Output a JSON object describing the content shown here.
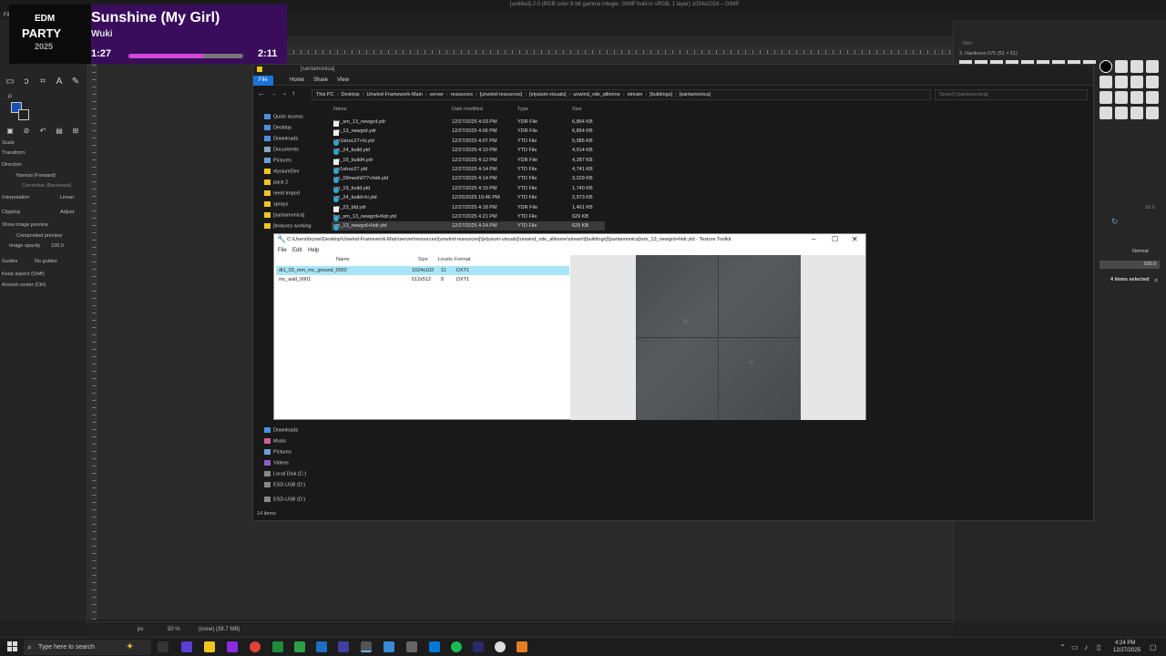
{
  "gimp": {
    "title": "[untitled]-2.0 (RGB color 8-bit gamma integer, GIMP built-in sRGB, 1 layer) 1024x1024 – GIMP",
    "menu": "File",
    "tool_options": {
      "scale": "Scale",
      "transform": "Transform:",
      "direction": "Direction",
      "normal_forward": "Normal (Forward)",
      "corrective_backward": "Corrective (Backward)",
      "interpolation": "Interpolation",
      "interpolation_val": "Linear",
      "clipping": "Clipping",
      "clipping_val": "Adjust",
      "show_preview": "Show image preview",
      "composited_preview": "Composited preview",
      "image_opacity": "Image opacity",
      "image_opacity_val": "100.0",
      "guides": "Guides",
      "guides_val": "No guides",
      "keep_aspect": "Keep aspect (Shift)",
      "around_center": "Around center (Ctrl)"
    },
    "status": {
      "unit": "px",
      "zoom": "50 %",
      "info": "(none) (38.7 MB)"
    },
    "dock": {
      "filter": "filter",
      "brush_name": "2. Hardness 075 (51 × 51)",
      "spacing": "10.0",
      "mode": "Normal",
      "opacity": "100.0",
      "items_selected": "4 items selected"
    }
  },
  "music": {
    "logo_line1": "EDM",
    "logo_line2": "PARTY",
    "logo_line3": "2025",
    "title": "Sunshine (My Girl)",
    "artist": "Wuki",
    "elapsed": "1:27",
    "total": "2:11",
    "progress": 0.66
  },
  "explorer": {
    "title": "[santamonica]",
    "tabs": [
      "File",
      "Home",
      "Share",
      "View"
    ],
    "path": [
      "This PC",
      "Desktop",
      "Unwind-Framework-Main",
      "server",
      "resources",
      "[unwind-resources]",
      "[elysium-visuals]",
      "unwind_vde_allinone",
      "stream",
      "[buildings]",
      "[santamonica]"
    ],
    "search_placeholder": "Search [santamonica]",
    "columns": {
      "name": "Name",
      "date": "Date modified",
      "type": "Type",
      "size": "Size"
    },
    "nav": [
      "Quick access",
      "Desktop",
      "Downloads",
      "Documents",
      "Pictures",
      "elysiumDev",
      "pack 2",
      "need import",
      "sprays",
      "[santamonica]",
      "[textures working",
      "Downloads",
      "Music",
      "Pictures",
      "Videos",
      "Local Disk (C:)",
      "ESD-USB (D:)",
      "ESD-USB (D:)"
    ],
    "files": [
      {
        "name": "hei_sm_13_newgrd.ydr",
        "date": "12/27/2025 4:03 PM",
        "type": "YDR File",
        "size": "6,854 KB",
        "icon": "doc"
      },
      {
        "name": "sm_13_newgrd.ydr",
        "date": "12/27/2025 4:06 PM",
        "type": "YDR File",
        "size": "6,854 KB",
        "icon": "doc"
      },
      {
        "name": "sm1struc27+hi.ytd",
        "date": "12/27/2025 4:07 PM",
        "type": "YTD File",
        "size": "5,985 KB",
        "icon": "edge"
      },
      {
        "name": "sm_24_build.ytd",
        "date": "12/27/2025 4:10 PM",
        "type": "YTD File",
        "size": "4,914 KB",
        "icon": "edge"
      },
      {
        "name": "sm_19_build4.ydr",
        "date": "12/27/2025 4:12 PM",
        "type": "YDR File",
        "size": "4,287 KB",
        "icon": "doc"
      },
      {
        "name": "sm1struc27.ytd",
        "date": "12/27/2025 4:14 PM",
        "type": "YTD File",
        "size": "4,741 KB",
        "icon": "edge"
      },
      {
        "name": "sm_09mesh077+hidr.ytd",
        "date": "12/27/2025 4:14 PM",
        "type": "YTD File",
        "size": "3,229 KB",
        "icon": "edge"
      },
      {
        "name": "sm_19_build.ytd",
        "date": "12/27/2025 4:15 PM",
        "type": "YTD File",
        "size": "1,740 KB",
        "icon": "edge"
      },
      {
        "name": "sm_24_build+hi.ytd",
        "date": "12/26/2025 10:46 PM",
        "type": "YTD File",
        "size": "2,973 KB",
        "icon": "edge"
      },
      {
        "name": "sm_23_bld.ydr",
        "date": "12/27/2025 4:18 PM",
        "type": "YDR File",
        "size": "1,461 KB",
        "icon": "doc"
      },
      {
        "name": "hei_sm_13_newgrd+hidr.ytd",
        "date": "12/27/2025 4:21 PM",
        "type": "YTD File",
        "size": "629 KB",
        "icon": "edge"
      },
      {
        "name": "sm_13_newgrd+hidr.ytd",
        "date": "12/27/2025 4:24 PM",
        "type": "YTD File",
        "size": "629 KB",
        "icon": "edge"
      }
    ],
    "status": "14 items"
  },
  "ttk": {
    "title": "C:\\Users\\brysw\\Desktop\\Unwind-Framework-Main\\server\\resources\\[unwind-resources]\\[elysium-visuals]\\unwind_vde_allinone\\stream\\[buildings]\\[santamonica]\\sm_13_newgrd+hidr.ytd - Texture Toolkit",
    "menu": [
      "File",
      "Edit",
      "Help"
    ],
    "columns": {
      "name": "Name",
      "size": "Size",
      "levels": "Levels",
      "format": "Format"
    },
    "rows": [
      {
        "name": "dt1_03_mm_mc_ground_0002",
        "size": "1024x102",
        "levels": "11",
        "format": "DXT1"
      },
      {
        "name": "mc_wall_0001",
        "size": "512x512",
        "levels": "8",
        "format": "DXT1"
      }
    ]
  },
  "taskbar": {
    "search": "Type here to search",
    "time": "4:24 PM",
    "date": "12/27/2025"
  }
}
